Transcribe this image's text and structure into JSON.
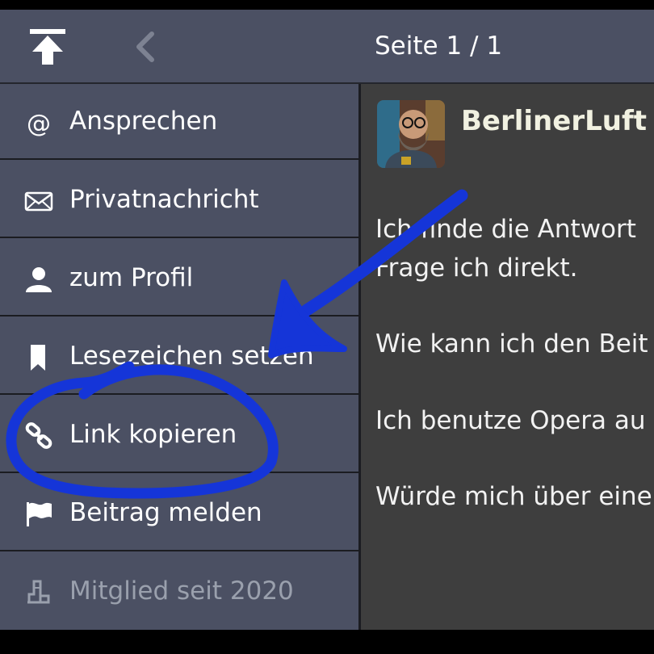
{
  "topbar": {
    "page_indicator": "Seite 1 / 1"
  },
  "menu": {
    "items": [
      {
        "label": "Ansprechen",
        "icon": "at-icon"
      },
      {
        "label": "Privatnachricht",
        "icon": "envelope-icon"
      },
      {
        "label": "zum Profil",
        "icon": "user-icon"
      },
      {
        "label": "Lesezeichen setzen",
        "icon": "bookmark-icon"
      },
      {
        "label": "Link kopieren",
        "icon": "link-icon"
      },
      {
        "label": "Beitrag melden",
        "icon": "flag-icon"
      },
      {
        "label": "Mitglied seit 2020",
        "icon": "member-icon"
      }
    ]
  },
  "post": {
    "username": "BerlinerLuft",
    "lines": [
      "Ich finde die Antwort",
      "Frage ich direkt.",
      "Wie kann ich den Beit",
      "Ich benutze Opera au",
      "Würde mich über eine"
    ]
  },
  "colors": {
    "menu_bg": "#4b5063",
    "content_bg": "#3e3e3e",
    "annotation": "#1535d8"
  }
}
